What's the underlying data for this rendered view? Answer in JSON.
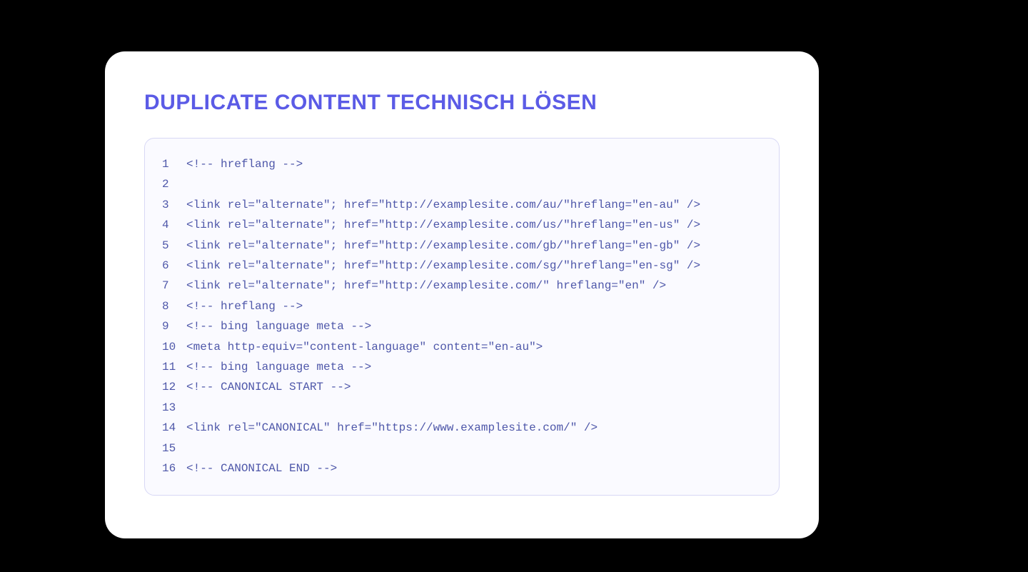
{
  "title": "DUPLICATE CONTENT TECHNISCH LÖSEN",
  "code": {
    "lines": [
      {
        "n": "1",
        "c": "<!-- hreflang -->"
      },
      {
        "n": "2",
        "c": ""
      },
      {
        "n": "3",
        "c": "<link rel=\"alternate\"; href=\"http://examplesite.com/au/\"hreflang=\"en-au\" />"
      },
      {
        "n": "4",
        "c": "<link rel=\"alternate\"; href=\"http://examplesite.com/us/\"hreflang=\"en-us\" />"
      },
      {
        "n": "5",
        "c": "<link rel=\"alternate\"; href=\"http://examplesite.com/gb/\"hreflang=\"en-gb\" />"
      },
      {
        "n": "6",
        "c": "<link rel=\"alternate\"; href=\"http://examplesite.com/sg/\"hreflang=\"en-sg\" />"
      },
      {
        "n": "7",
        "c": "<link rel=\"alternate\"; href=\"http://examplesite.com/\" hreflang=\"en\" />"
      },
      {
        "n": "8",
        "c": "<!-- hreflang -->"
      },
      {
        "n": "9",
        "c": "<!-- bing language meta -->"
      },
      {
        "n": "10",
        "c": "<meta http-equiv=\"content-language\" content=\"en-au\">"
      },
      {
        "n": "11",
        "c": "<!-- bing language meta -->"
      },
      {
        "n": "12",
        "c": "<!-- CANONICAL START -->"
      },
      {
        "n": "13",
        "c": ""
      },
      {
        "n": "14",
        "c": "<link rel=\"CANONICAL\" href=\"https://www.examplesite.com/\" />"
      },
      {
        "n": "15",
        "c": ""
      },
      {
        "n": "16",
        "c": "<!-- CANONICAL END -->"
      }
    ]
  }
}
